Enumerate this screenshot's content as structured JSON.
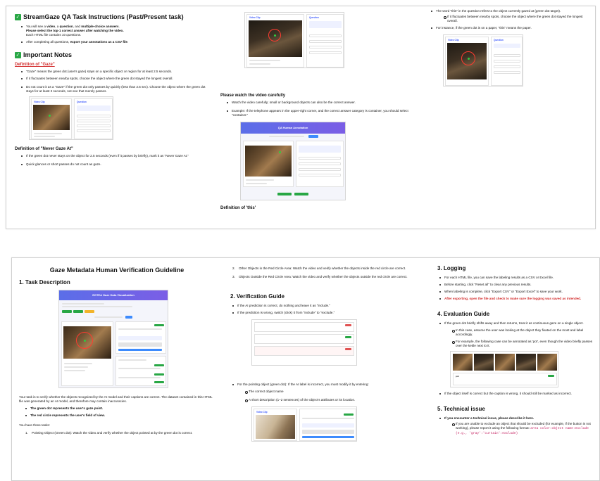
{
  "top_sheet": {
    "col1": {
      "title": "StreamGaze QA Task Instructions (Past/Present task)",
      "intro_items": [
        {
          "pre": "You will see a ",
          "b1": "video",
          "mid": ", a ",
          "b2": "question",
          "mid2": ", and ",
          "b3": "multiple-choice answers",
          "post": "."
        },
        {
          "text": "Please select the top-1 correct answer after watching the video."
        },
        {
          "text": "Each HTML file contains 10 questions."
        },
        {
          "pre": "After completing all questions, ",
          "b1": "export your annotations as a CSV file",
          "post": "."
        }
      ],
      "notes_title": "Important Notes",
      "gaze_def_title": "Definition of \"Gaze\"",
      "gaze_items": [
        "\"Gaze\" means the green dot (user's gaze) stays on a specific object or region for at least 2.5 seconds.",
        "If it fluctuates between nearby spots, choose the object where the green dot stayed the longest overall.",
        "Do not count it as a \"Gaze\" if the green dot only passes by quickly (less than 2.5 sec). Choose the object where the green dot stays for at least 2 seconds, not one that merely passes."
      ],
      "never_gaze_title": "Definition of \"Never Gaze At\"",
      "never_items": [
        "If the green dot never stays on the object for 2.5 seconds (even if it passes by briefly), mark it as \"Never Gaze At.\"",
        "Quick glances or short passes do not count as gaze."
      ],
      "mini_video_label": "Video Clip",
      "mini_question_label": "Question"
    },
    "col2": {
      "mini_video_label": "Video Clip",
      "mini_question_label": "Question",
      "watch_title": "Please watch the video carefully",
      "watch_items": [
        "Watch the video carefully; small or background objects can also be the correct answer.",
        "Example: If the telephone appears in the upper-right corner, and the correct answer category is container, you should select \"container.\""
      ],
      "qa_banner": "QA Human Annotation",
      "this_title": "Definition of 'this'"
    },
    "col3": {
      "this_items": [
        "The word \"this\" in the question refers to the object currently gazed at (green dot target).",
        "For instance, if the green dot is on a paper, \"this\" means the paper."
      ],
      "this_sub": "If it fluctuates between nearby spots, choose the object where the green dot stayed the longest overall.",
      "mini_video_label": "Video Clip",
      "mini_question_label": "Question"
    }
  },
  "bottom_sheet": {
    "col1": {
      "doc_title": "Gaze Metadata Human Verification Guideline",
      "section1": "1. Task Description",
      "viz_banner": "EGTEA Gaze Data Visualization",
      "task_para": "Your task is to verify whether the objects recognized by the AI model and their captions are correct. The dataset contained in this HTML file was generated by an AI model, and therefore may contain inaccuracies.",
      "dot_items": [
        "The green dot represents the user's gaze point.",
        "The red circle represents the user's field of view."
      ],
      "three_tasks": "You have three tasks:",
      "task1": "Pointing Object (Green dot): Watch the video and verify whether the object pointed at by the green dot is correct."
    },
    "col2": {
      "task2": "Other Objects in the Red Circle Area: Watch the video and verify whether the objects inside the red circle are correct.",
      "task3": "Objects Outside the Red Circle Area: Watch the video and verify whether the objects outside the red circle are correct.",
      "section2": "2. Verification Guide",
      "verify_items": [
        "If the AI prediction is correct, do nothing and leave it as \"include.\"",
        "If the prediction is wrong, switch (click) it from \"include\" to \"exclude.\""
      ],
      "pointing_item": "For the pointing object (green dot): If the AI label is incorrect, you must modify it by entering:",
      "pointing_sub": [
        "The correct object name",
        "A short description (1–2 sentences) of the object's attributes or its location."
      ],
      "mini_video_label": "Video Clip"
    },
    "col3": {
      "section3": "3. Logging",
      "logging_items": [
        "For each HTML file, you can save the labeling results as a CSV or Excel file.",
        "Before starting, click \"Reset all\" to clear any previous results.",
        "When labeling is complete, click \"Export CSV\" or \"Export Excel\" to save your work.",
        "After exporting, open the file and check to make sure the logging was saved as intended."
      ],
      "section4": "4. Evaluation Guide",
      "eval_item": "If the green dot briefly shifts away and then returns, treat it as continuous gaze on a single object.",
      "eval_sub": [
        "In this case, assume the user was looking at the object they fixated on the most and label accordingly.",
        "For example, the following case can be annotated as 'pot', even though the video briefly passes over the kettle next to it."
      ],
      "eval_caption_label": "pot",
      "eval_item2": "If the object itself is correct but the caption is wrong, it should still be marked as incorrect.",
      "section5": "5. Technical issue",
      "tech_item": "If you encounter a technical issue, please describe it here.",
      "tech_sub": "If you are unable to exclude an object that should be excluded (for example, if the button is not working), please report it using the following format:",
      "tech_code": "area color:object name:exclude (e.g., 'gray':'curtain':exclude)"
    }
  }
}
